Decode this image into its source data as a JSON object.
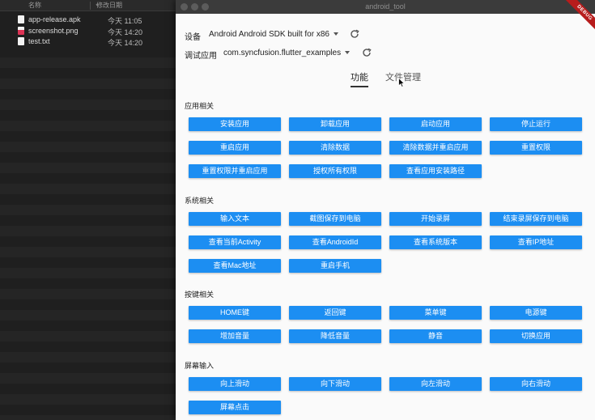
{
  "finder": {
    "col_name": "名称",
    "col_date": "修改日期",
    "files": [
      {
        "name": "app-release.apk",
        "date": "今天 11:05",
        "type": "apk"
      },
      {
        "name": "screenshot.png",
        "date": "今天 14:20",
        "type": "png"
      },
      {
        "name": "test.txt",
        "date": "今天 14:20",
        "type": "txt"
      }
    ]
  },
  "window": {
    "title": "android_tool",
    "badge": "DEBUG"
  },
  "device": {
    "label": "设备",
    "value": "Android Android SDK built for x86"
  },
  "app": {
    "label": "调试应用",
    "value": "com.syncfusion.flutter_examples"
  },
  "tabs": [
    {
      "label": "功能",
      "active": true
    },
    {
      "label": "文件管理",
      "active": false
    }
  ],
  "sections": [
    {
      "title": "应用相关",
      "buttons": [
        "安装应用",
        "卸载应用",
        "启动应用",
        "停止运行",
        "重启应用",
        "清除数据",
        "清除数据并重启应用",
        "重置权限",
        "重置权限并重启应用",
        "授权所有权限",
        "查看应用安装路径"
      ]
    },
    {
      "title": "系统相关",
      "buttons": [
        "输入文本",
        "截图保存到电脑",
        "开始录屏",
        "结束录屏保存到电脑",
        "查看当前Activity",
        "查看AndroidId",
        "查看系统版本",
        "查看IP地址",
        "查看Mac地址",
        "重启手机"
      ]
    },
    {
      "title": "按键相关",
      "buttons": [
        "HOME键",
        "返回键",
        "菜单键",
        "电源键",
        "增加音量",
        "降低音量",
        "静音",
        "切换应用"
      ]
    },
    {
      "title": "屏幕输入",
      "buttons": [
        "向上滑动",
        "向下滑动",
        "向左滑动",
        "向右滑动",
        "屏幕点击"
      ]
    }
  ],
  "colors": {
    "button": "#1c8ef2",
    "debug_banner": "#b71c1c"
  }
}
